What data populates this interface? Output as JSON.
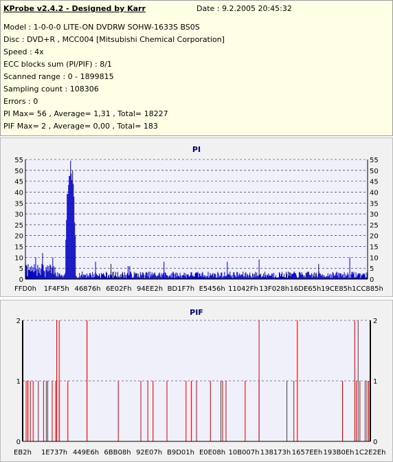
{
  "info": {
    "title": "KProbe v2.4.2 - Designed by Karr",
    "date": "Date : 9.2.2005 20:45:32",
    "lines": [
      "Model : 1-0-0-0 LITE-ON DVDRW SOHW-1633S BS0S",
      "Disc : DVD+R , MCC004 [Mitsubishi Chemical Corporation]",
      "Speed : 4x",
      "ECC blocks sum (PI/PIF) : 8/1",
      "Scanned range : 0 - 1899815",
      "Sampling count : 108306",
      "Errors : 0",
      "PI Max= 56 , Average= 1,31 , Total= 18227",
      "PIF Max= 2 , Average= 0,00 , Total= 183"
    ]
  },
  "colors": {
    "pi": "#0000c0",
    "pif": "#d00000",
    "plot_bg": "#f0f0fa",
    "grid": "#000080"
  },
  "chart_data": [
    {
      "type": "bar",
      "title": "PI",
      "ylim": [
        0,
        55
      ],
      "yticks": [
        0,
        5,
        10,
        15,
        20,
        25,
        30,
        35,
        40,
        45,
        50,
        55
      ],
      "xtick_labels": [
        "FFD0h",
        "1F4F5h",
        "46876h",
        "6E02Fh",
        "94EE2h",
        "BD1F7h",
        "E5456h",
        "11042Fh",
        "13F028h",
        "16DE65h",
        "19CE85h",
        "1CC885h"
      ],
      "grid": true,
      "baseline_noise": 3,
      "peak_region": {
        "x_start": 0.117,
        "x_end": 0.147,
        "max": 56
      },
      "spikes": [
        {
          "x": 0.03,
          "y": 10
        },
        {
          "x": 0.05,
          "y": 12
        },
        {
          "x": 0.08,
          "y": 10
        },
        {
          "x": 0.205,
          "y": 8
        },
        {
          "x": 0.25,
          "y": 7
        },
        {
          "x": 0.3,
          "y": 6
        },
        {
          "x": 0.305,
          "y": 6
        },
        {
          "x": 0.405,
          "y": 8
        },
        {
          "x": 0.59,
          "y": 8
        },
        {
          "x": 0.683,
          "y": 9
        },
        {
          "x": 0.857,
          "y": 7
        },
        {
          "x": 0.948,
          "y": 10
        }
      ]
    },
    {
      "type": "bar",
      "title": "PIF",
      "ylim": [
        0,
        2
      ],
      "yticks": [
        0,
        1,
        2
      ],
      "xtick_labels": [
        "EB2h",
        "1E737h",
        "449E6h",
        "6BB08h",
        "92E07h",
        "B9D01h",
        "E0E08h",
        "10B007h",
        "138173h",
        "1657EEh",
        "193B0Eh",
        "1C2E2Eh"
      ],
      "grid": true,
      "ones": [
        0.01,
        0.015,
        0.022,
        0.03,
        0.045,
        0.06,
        0.068,
        0.072,
        0.085,
        0.095,
        0.105,
        0.13,
        0.275,
        0.34,
        0.36,
        0.375,
        0.415,
        0.47,
        0.485,
        0.5,
        0.54,
        0.57,
        0.575,
        0.585,
        0.64,
        0.68,
        0.76,
        0.78,
        0.92,
        0.96,
        0.97,
        0.985,
        0.99,
        0.995
      ],
      "twos": [
        0.098,
        0.105,
        0.185,
        0.68,
        0.79,
        0.955,
        0.965
      ]
    }
  ]
}
